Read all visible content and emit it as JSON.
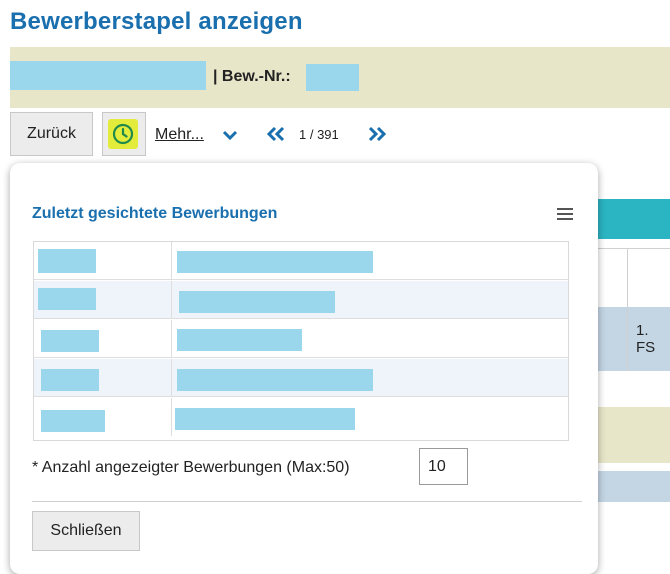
{
  "page": {
    "title": "Bewerberstapel anzeigen"
  },
  "header": {
    "bew_nr_label": "| Bew.-Nr.:"
  },
  "toolbar": {
    "back_label": "Zurück",
    "more_label": "Mehr...",
    "pager_text": "1 / 391",
    "history_icon": "clock-icon",
    "prev_icon": "double-chevron-left-icon",
    "next_icon": "double-chevron-right-icon"
  },
  "background": {
    "cell_text": "1. FS"
  },
  "popup": {
    "title": "Zuletzt gesichtete Bewerbungen",
    "menu_icon": "hamburger-menu-icon",
    "rows_count_visible": 5,
    "count_label": "* Anzahl angezeigter Bewerbungen (Max:50)",
    "count_value": "10",
    "close_label": "Schließen"
  },
  "colors": {
    "accent_blue": "#1a6fae",
    "header_band": "#e8e6c9",
    "redaction": "#9ad7ec",
    "history_highlight": "#e3ec3b",
    "teal": "#2bb5c3"
  }
}
